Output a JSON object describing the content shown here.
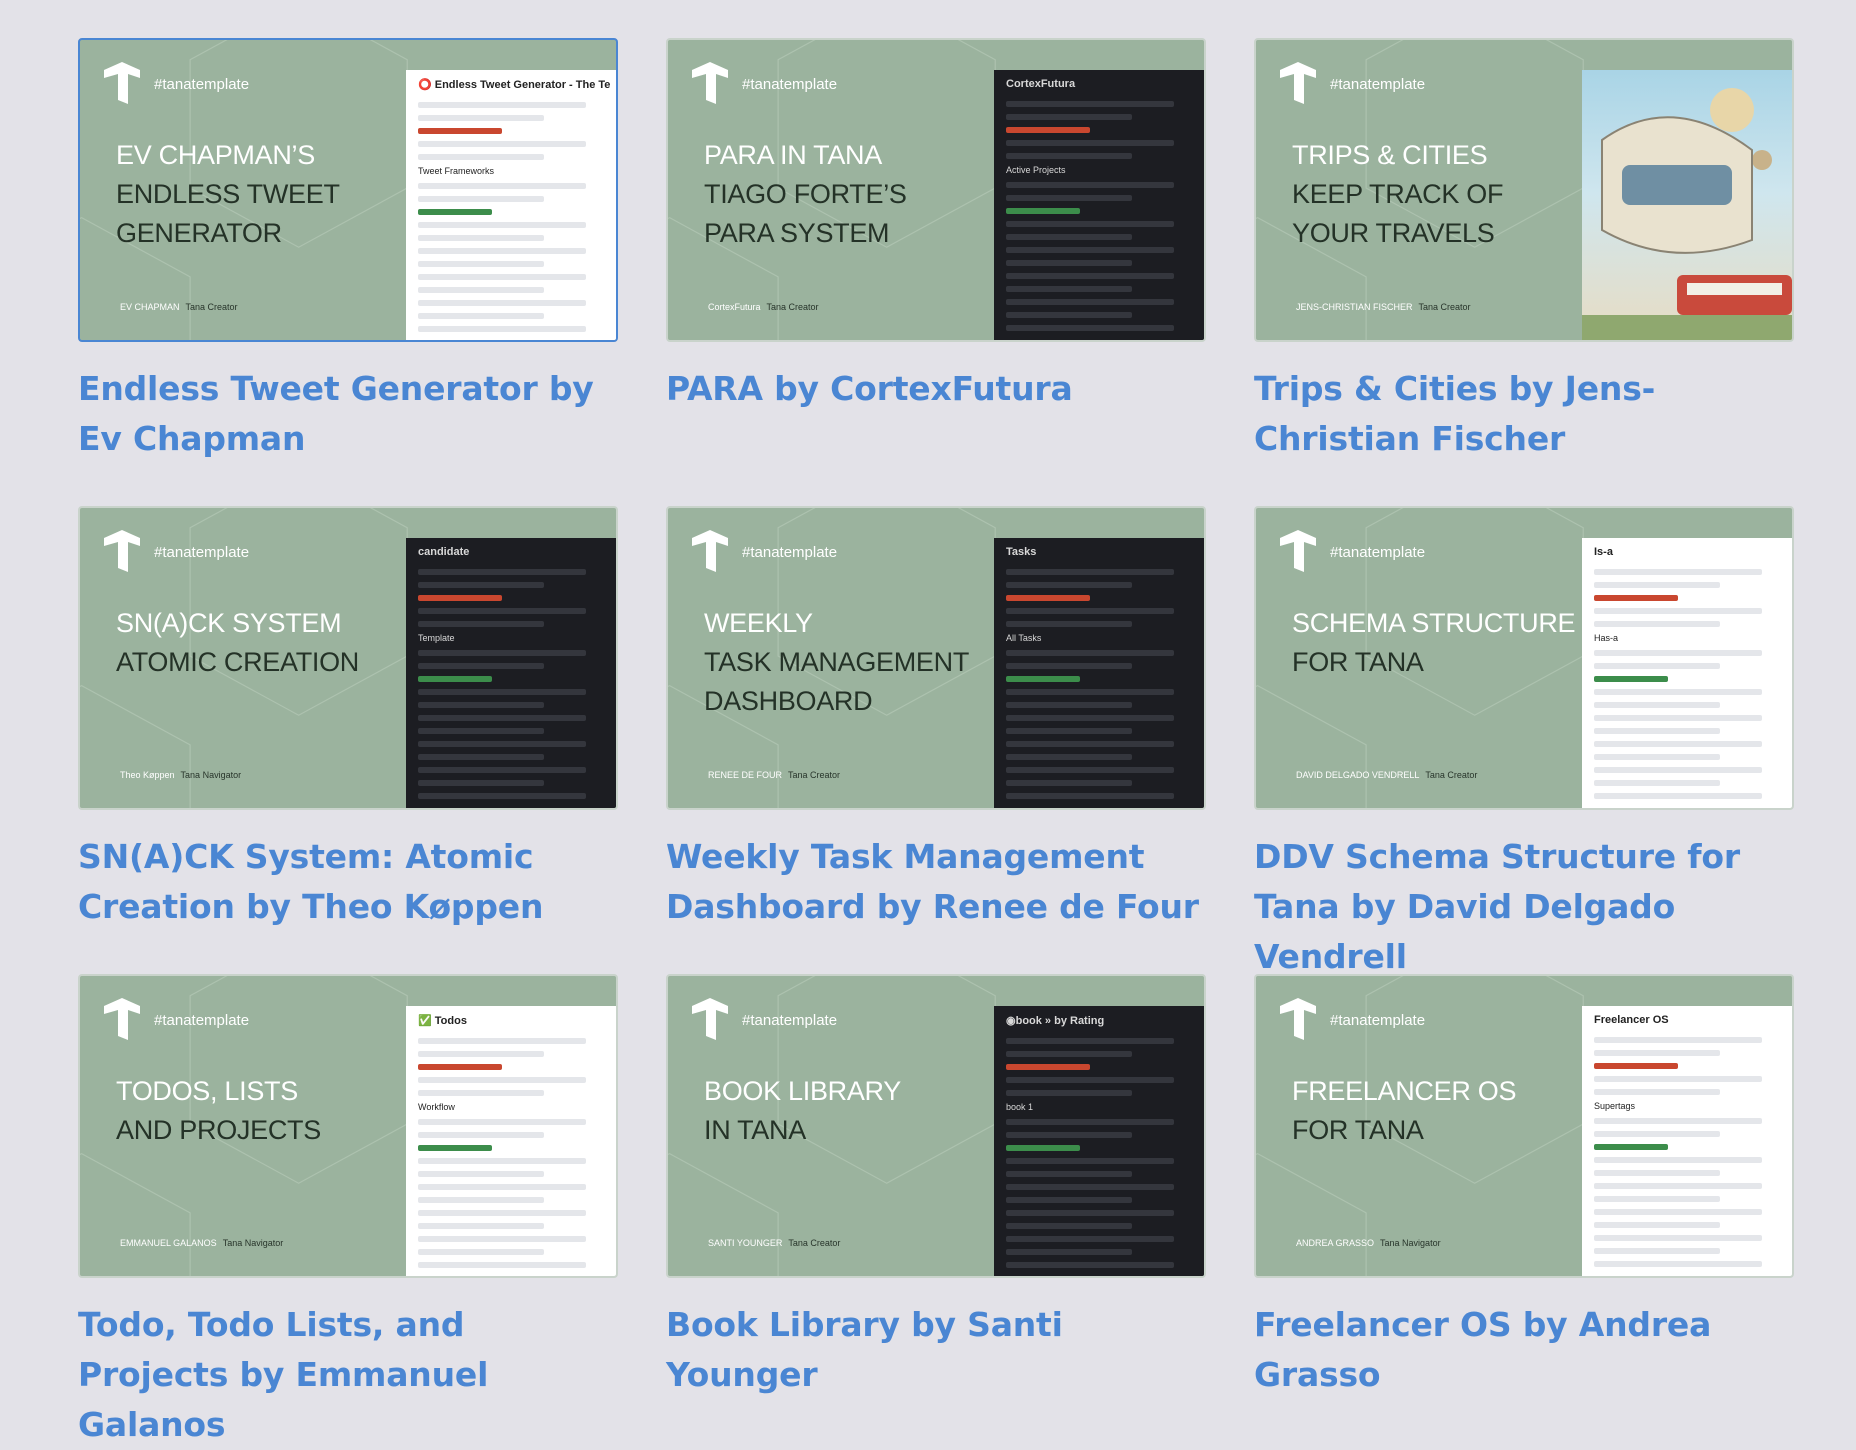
{
  "colors": {
    "accent": "#4a86d3",
    "card_bg": "#9bb39e",
    "page_bg": "#e3e2e8"
  },
  "cards": [
    {
      "tag": "#tanatemplate",
      "big": [
        "EV CHAPMAN’S",
        "ENDLESS TWEET",
        "GENERATOR"
      ],
      "author": "EV CHAPMAN",
      "role": "Tana Creator",
      "shot_title": "⭕ Endless Tweet Generator - The Te",
      "shot_sub": "Tweet Frameworks",
      "title": "Endless Tweet Generator by Ev Chapman"
    },
    {
      "tag": "#tanatemplate",
      "big": [
        "PARA IN TANA",
        "TIAGO FORTE’S",
        "PARA SYSTEM"
      ],
      "author": "CortexFutura",
      "role": "Tana Creator",
      "shot_title": "CortexFutura",
      "shot_sub": "Active Projects",
      "title": "PARA by CortexFutura"
    },
    {
      "tag": "#tanatemplate",
      "big": [
        "TRIPS & CITIES",
        "KEEP TRACK OF",
        "YOUR TRAVELS"
      ],
      "author": "JENS-CHRISTIAN FISCHER",
      "role": "Tana Creator",
      "title": "Trips & Cities by Jens-Christian Fischer"
    },
    {
      "tag": "#tanatemplate",
      "big": [
        "SN(A)CK SYSTEM",
        "ATOMIC CREATION",
        ""
      ],
      "author": "Theo Køppen",
      "role": "Tana Navigator",
      "shot_title": "candidate",
      "shot_sub": "Template",
      "title": "SN(A)CK System: Atomic Creation by Theo Køppen"
    },
    {
      "tag": "#tanatemplate",
      "big": [
        "WEEKLY",
        "TASK MANAGEMENT",
        "DASHBOARD"
      ],
      "author": "RENEE DE FOUR",
      "role": "Tana Creator",
      "shot_title": "Tasks",
      "shot_sub": "All Tasks",
      "title": "Weekly Task Management Dashboard by Renee de Four"
    },
    {
      "tag": "#tanatemplate",
      "big": [
        "SCHEMA STRUCTURE",
        "FOR TANA",
        ""
      ],
      "author": "DAVID DELGADO VENDRELL",
      "role": "Tana Creator",
      "shot_title": "Is-a",
      "shot_sub": "Has-a",
      "title": "DDV Schema Structure for Tana by David Delgado Vendrell"
    },
    {
      "tag": "#tanatemplate",
      "big": [
        "TODOS, LISTS",
        "AND PROJECTS",
        ""
      ],
      "author": "EMMANUEL GALANOS",
      "role": "Tana Navigator",
      "shot_title": "✅ Todos",
      "shot_sub": "Workflow",
      "title": "Todo, Todo Lists, and Projects by Emmanuel Galanos"
    },
    {
      "tag": "#tanatemplate",
      "big": [
        "BOOK LIBRARY",
        "IN TANA",
        ""
      ],
      "author": "SANTI YOUNGER",
      "role": "Tana Creator",
      "shot_title": "◉book » by Rating",
      "shot_sub": "book 1",
      "title": "Book Library by Santi Younger"
    },
    {
      "tag": "#tanatemplate",
      "big": [
        "FREELANCER OS",
        "FOR TANA",
        ""
      ],
      "author": "ANDREA GRASSO",
      "role": "Tana Navigator",
      "shot_title": "Freelancer OS",
      "shot_sub": "Supertags",
      "title": "Freelancer OS by Andrea Grasso"
    }
  ]
}
